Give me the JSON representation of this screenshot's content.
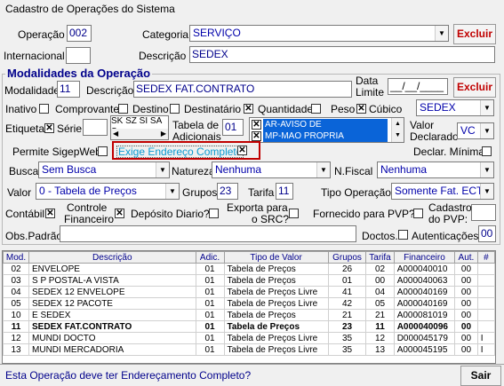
{
  "window": {
    "title": "Cadastro de Operações do Sistema"
  },
  "top": {
    "operacao_label": "Operação",
    "operacao_value": "002",
    "categoria_label": "Categoria",
    "categoria_value": "SERVIÇO",
    "excluir_label": "Excluir",
    "internacional_label": "Internacional",
    "descricao_label": "Descrição",
    "descricao_value": "SEDEX"
  },
  "modalidades": {
    "group_title": "Modalidades da Operação",
    "modalidade_label": "Modalidade",
    "modalidade_value": "11",
    "descricao_label": "Descrição",
    "descricao_value": "SEDEX FAT.CONTRATO",
    "data_limite_label1": "Data",
    "data_limite_label2": "Limite",
    "data_limite_value": "__/__/____",
    "excluir_label": "Excluir",
    "inativo_label": "Inativo",
    "comprovante_label": "Comprovante",
    "destino_label": "Destino",
    "destinatario_label": "Destinatário",
    "quantidade_label": "Quantidade",
    "peso_label": "Peso",
    "cubico_label": "Cúbico",
    "peso_unit_value": "SEDEX",
    "etiqueta_label": "Etiqueta",
    "serie_label": "Série",
    "serie_list": "SK SZ SI SA S",
    "tabela_label1": "Tabela de",
    "tabela_label2": "Adicionais",
    "tabela_value": "01",
    "adicionais": [
      "AR-AVISO DE RECEBIMENTO",
      "MP-MAO PROPRIA"
    ],
    "valor_declarado_label1": "Valor",
    "valor_declarado_label2": "Declarado",
    "valor_declarado_value": "VC",
    "permite_sigepweb_label": "Permite SigepWeb",
    "exige_endereco_label": "Exige Endereço Completo",
    "declar_minima_label": "Declar. Mínima",
    "busca_label": "Busca",
    "busca_value": "Sem Busca",
    "natureza_label": "Natureza",
    "natureza_value": "Nenhuma",
    "nfiscal_label": "N.Fiscal",
    "nfiscal_value": "Nenhuma",
    "valor_label": "Valor",
    "valor_value": "0 - Tabela de Preços",
    "grupos_label": "Grupos",
    "grupos_value": "23",
    "tarifa_label": "Tarifa",
    "tarifa_value": "11",
    "tipo_operacao_label": "Tipo Operação",
    "tipo_operacao_value": "Somente Fat. ECT",
    "contabil_label": "Contábil",
    "controle_financeiro_label1": "Controle",
    "controle_financeiro_label2": "Financeiro",
    "deposito_diario_label": "Depósito Diario?",
    "exporta_src_label1": "Exporta para",
    "exporta_src_label2": "o SRC?",
    "fornecido_pvp_label": "Fornecido para PVP?",
    "cadastro_pvp_label1": "Cadastro",
    "cadastro_pvp_label2": "do PVP:",
    "obs_padrao_label": "Obs.Padrão",
    "doctos_label": "Doctos.",
    "autenticacoes_label": "Autenticações",
    "autenticacoes_value": "00"
  },
  "grid": {
    "headers": [
      "Mod.",
      "Descrição",
      "Adic.",
      "Tipo de Valor",
      "Grupos",
      "Tarifa",
      "Financeiro",
      "Aut.",
      "#"
    ],
    "rows": [
      [
        "02",
        "ENVELOPE",
        "01",
        "Tabela de Preços",
        "26",
        "02",
        "A000040010",
        "00",
        ""
      ],
      [
        "03",
        "S P POSTAL-A VISTA",
        "01",
        "Tabela de Preços",
        "01",
        "00",
        "A000040063",
        "00",
        ""
      ],
      [
        "04",
        "SEDEX 12 ENVELOPE",
        "01",
        "Tabela de Preços Livre",
        "41",
        "04",
        "A000040169",
        "00",
        ""
      ],
      [
        "05",
        "SEDEX 12 PACOTE",
        "01",
        "Tabela de Preços Livre",
        "42",
        "05",
        "A000040169",
        "00",
        ""
      ],
      [
        "10",
        "E SEDEX",
        "01",
        "Tabela de Preços",
        "21",
        "21",
        "A000081019",
        "00",
        ""
      ],
      [
        "11",
        "SEDEX FAT.CONTRATO",
        "01",
        "Tabela de Preços",
        "23",
        "11",
        "A000040096",
        "00",
        ""
      ],
      [
        "12",
        "MUNDI DOCTO",
        "01",
        "Tabela de Preços Livre",
        "35",
        "12",
        "D000045179",
        "00",
        "I"
      ],
      [
        "13",
        "MUNDI MERCADORIA",
        "01",
        "Tabela de Preços Livre",
        "35",
        "13",
        "A000045195",
        "00",
        "I"
      ]
    ]
  },
  "status": {
    "message": "Esta Operação deve ter Endereçamento Completo?",
    "sair_label": "Sair"
  }
}
